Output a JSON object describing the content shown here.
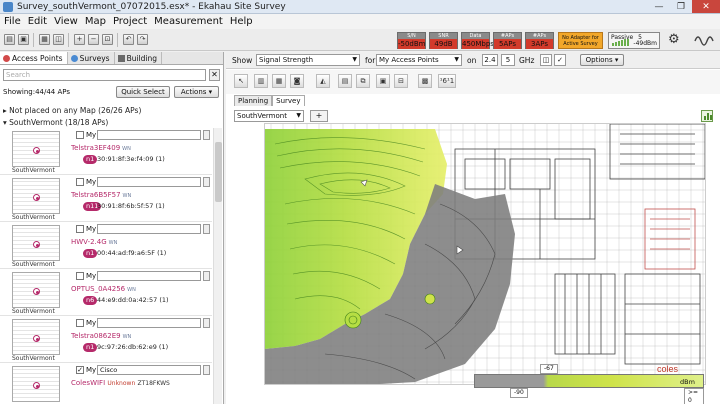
{
  "window": {
    "title": "Survey_southVermont_07072015.esx* - Ekahau Site Survey",
    "controls": [
      "—",
      "❐",
      "✕"
    ]
  },
  "menu": [
    "File",
    "Edit",
    "View",
    "Map",
    "Project",
    "Measurement",
    "Help"
  ],
  "toolbar": {
    "icons": [
      "open-icon",
      "save-icon",
      "print-icon",
      "screenshot-icon",
      "zoom-in-icon",
      "zoom-out-icon",
      "zoom-fit-icon",
      "undo-icon",
      "redo-icon"
    ],
    "stats": [
      {
        "key": "S/N",
        "value": "-50dBm"
      },
      {
        "key": "SNR",
        "value": "49dB"
      },
      {
        "key": "Data",
        "value": "450Mbps"
      },
      {
        "key": "#APs",
        "value": "5APs"
      },
      {
        "key": "#APs",
        "value": "3APs"
      }
    ],
    "adapter": "No Adapter for Active Survey",
    "passive": {
      "label": "Passive",
      "count": "5",
      "level": "-49dBm"
    },
    "colors": {
      "stat_bad": "#d23a2b",
      "adapter": "#f2a72a"
    }
  },
  "left": {
    "tabs": [
      {
        "label": "Access Points",
        "icon_color": "#d24a4a"
      },
      {
        "label": "Surveys",
        "icon_color": "#4a8ad2"
      },
      {
        "label": "Building",
        "icon_color": "#6a6a6a"
      }
    ],
    "search_placeholder": "Search",
    "clear": "✕",
    "showing": "Showing:44/44 APs",
    "quick_select": "Quick Select",
    "actions": "Actions ▾",
    "groups": [
      {
        "label": "▸  Not placed on any Map (26/26 APs)"
      },
      {
        "label": "▾  SouthVermont (18/18 APs)"
      }
    ],
    "aps": [
      {
        "name": "Telstra3EF409",
        "phy": "WN",
        "badge": "n1",
        "mac": "30:91:8f:3e:f4:09 (1)",
        "map": "SouthVermont",
        "my_value": "",
        "checked": false
      },
      {
        "name": "Telstra6B5F57",
        "phy": "WN",
        "badge": "n11",
        "mac": "30:91:8f:6b:5f:57 (1)",
        "map": "SouthVermont",
        "my_value": "",
        "checked": false
      },
      {
        "name": "HWV-2.4G",
        "phy": "WN",
        "badge": "n1",
        "mac": "00:44:ad:f9:a6:5F (1)",
        "map": "SouthVermont",
        "my_value": "",
        "checked": false
      },
      {
        "name": "OPTUS_0A4256",
        "phy": "WN",
        "badge": "n6",
        "mac": "44:e9:dd:0a:42:57 (1)",
        "map": "SouthVermont",
        "my_value": "",
        "checked": false
      },
      {
        "name": "Telstra0862E9",
        "phy": "WN",
        "badge": "n1",
        "mac": "9c:97:26:db:62:e9 (1)",
        "map": "SouthVermont",
        "my_value": "",
        "checked": false
      },
      {
        "name": "ColesWIFI",
        "phy": "",
        "badge": "",
        "mac": "",
        "map": "SouthVermont",
        "my_value": "Cisco",
        "checked": true,
        "vendor": "Unknown",
        "vendor_mac": "ZT18FKWS"
      }
    ]
  },
  "right": {
    "show_label": "Show",
    "show_value": "Signal Strength",
    "for_label": "for",
    "for_value": "My Access Points",
    "on_label": "on",
    "band1": "2.4",
    "band2": "5",
    "ghz": "GHz",
    "options": "Options ▾",
    "subtabs": [
      "Planning",
      "Survey"
    ],
    "map_select": "SouthVermont",
    "plus": "+",
    "legend": {
      "min": "-90",
      "mid": "-67",
      "unit": "dBm",
      "max": ">= 0"
    },
    "map_labels": [
      "coles"
    ]
  }
}
